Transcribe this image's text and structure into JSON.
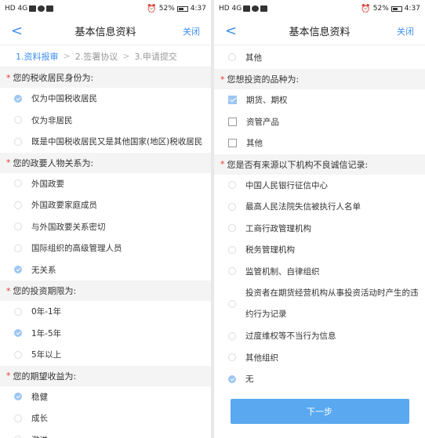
{
  "left": {
    "status": {
      "left": "HD 4G",
      "right_battery": "52%",
      "time": "4:37"
    },
    "nav": {
      "back": "<",
      "title": "基本信息资料",
      "close": "关闭"
    },
    "steps": [
      {
        "label": "1.资料报审",
        "active": true
      },
      {
        "label": "2.签署协议",
        "active": false
      },
      {
        "label": "3.申请提交",
        "active": false
      }
    ],
    "step_sep": ">",
    "sections": [
      {
        "title": "您的税收居民身份为:",
        "options": [
          {
            "label": "仅为中国税收居民",
            "checked": true
          },
          {
            "label": "仅为非居民",
            "checked": false
          },
          {
            "label": "既是中国税收居民又是其他国家(地区)税收居民",
            "checked": false
          }
        ]
      },
      {
        "title": "您的政要人物关系为:",
        "options": [
          {
            "label": "外国政要",
            "checked": false
          },
          {
            "label": "外国政要家庭成员",
            "checked": false
          },
          {
            "label": "与外国政要关系密切",
            "checked": false
          },
          {
            "label": "国际组织的高级管理人员",
            "checked": false
          },
          {
            "label": "无关系",
            "checked": true
          }
        ]
      },
      {
        "title": "您的投资期限为:",
        "options": [
          {
            "label": "0年-1年",
            "checked": false
          },
          {
            "label": "1年-5年",
            "checked": true
          },
          {
            "label": "5年以上",
            "checked": false
          }
        ]
      },
      {
        "title": "您的期望收益为:",
        "options": [
          {
            "label": "稳健",
            "checked": true
          },
          {
            "label": "成长",
            "checked": false
          },
          {
            "label": "激进",
            "checked": false
          }
        ]
      }
    ]
  },
  "right": {
    "status": {
      "left": "HD 4G",
      "right_battery": "52%",
      "time": "4:37"
    },
    "nav": {
      "back": "<",
      "title": "基本信息资料",
      "close": "关闭"
    },
    "top_option": {
      "label": "其他",
      "checked": false
    },
    "product_section": {
      "title": "您想投资的品种为:",
      "options": [
        {
          "label": "期货、期权",
          "checked": true
        },
        {
          "label": "资管产品",
          "checked": false
        },
        {
          "label": "其他",
          "checked": false
        }
      ]
    },
    "record_section": {
      "title": "您是否有来源以下机构不良诚信记录:",
      "options": [
        {
          "label": "中国人民银行征信中心",
          "checked": false
        },
        {
          "label": "最高人民法院失信被执行人名单",
          "checked": false
        },
        {
          "label": "工商行政管理机构",
          "checked": false
        },
        {
          "label": "税务管理机构",
          "checked": false
        },
        {
          "label": "监管机制、自律组织",
          "checked": false
        },
        {
          "label": "投资者在期货经营机构从事投资活动时产生的违约行为记录",
          "checked": false,
          "tall": true
        },
        {
          "label": "过度维权等不当行为信息",
          "checked": false
        },
        {
          "label": "其他组织",
          "checked": false
        },
        {
          "label": "无",
          "checked": true
        }
      ]
    },
    "next_button": "下一步"
  }
}
